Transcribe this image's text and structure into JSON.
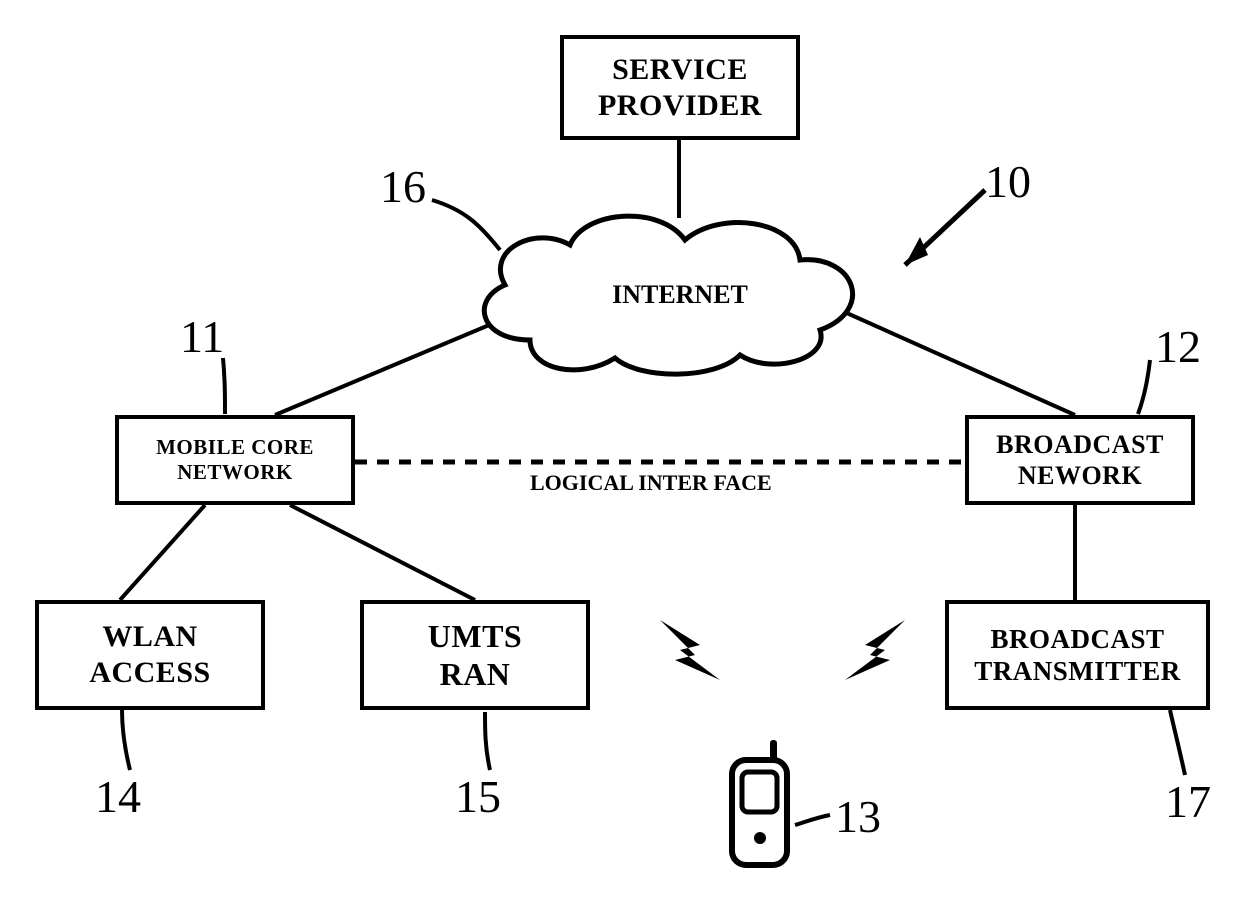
{
  "nodes": {
    "service_provider": "SERVICE\nPROVIDER",
    "internet": "INTERNET",
    "mobile_core": "MOBILE CORE\nNETWORK",
    "broadcast_network": "BROADCAST\nNEWORK",
    "wlan_access": "WLAN\nACCESS",
    "umts_ran": "UMTS\nRAN",
    "broadcast_tx": "BROADCAST\nTRANSMITTER"
  },
  "labels": {
    "logical_interface": "LOGICAL INTER FACE"
  },
  "refs": {
    "r10": "10",
    "r11": "11",
    "r12": "12",
    "r13": "13",
    "r14": "14",
    "r15": "15",
    "r16": "16",
    "r17": "17"
  }
}
